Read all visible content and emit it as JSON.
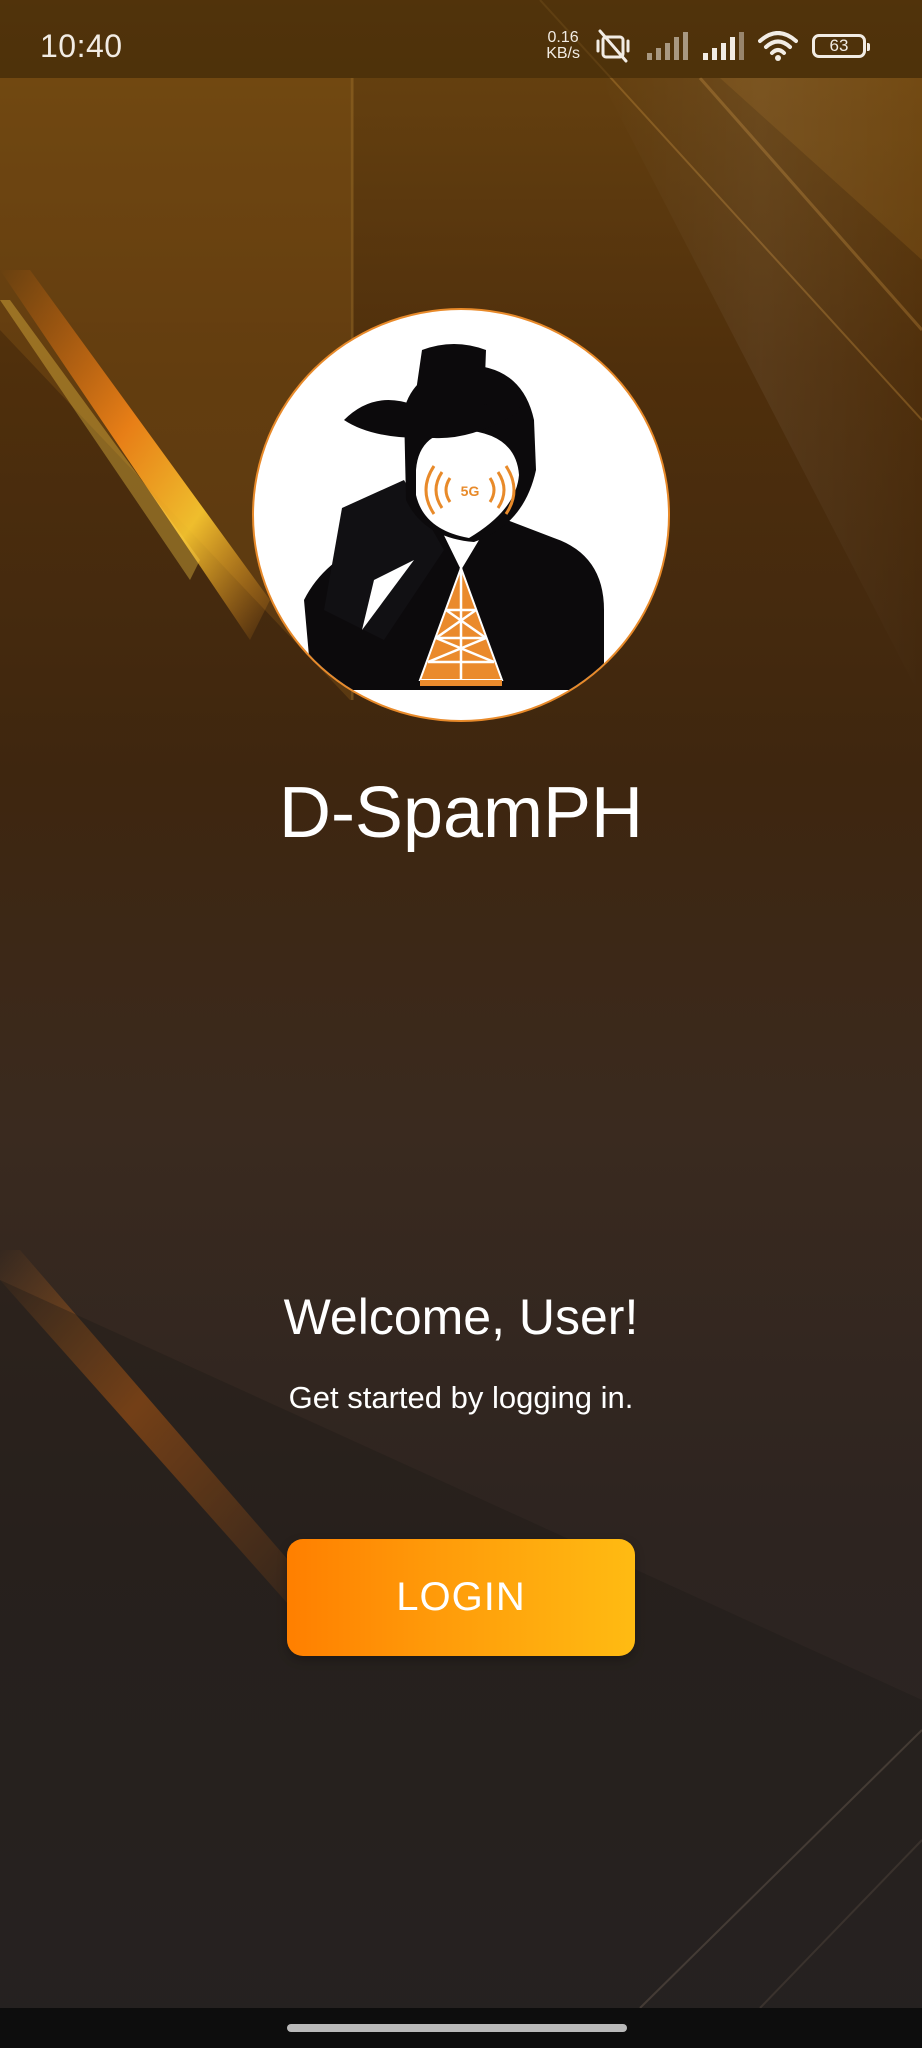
{
  "status_bar": {
    "time": "10:40",
    "net_speed_value": "0.16",
    "net_speed_unit": "KB/s",
    "battery_level": "63",
    "icons": [
      "mute-vibrate-icon",
      "signal-bars-icon",
      "signal-bars-icon",
      "wifi-icon",
      "battery-icon"
    ]
  },
  "app": {
    "name": "D-SpamPH",
    "logo_badge_text": "5G"
  },
  "welcome": {
    "heading": "Welcome, User!",
    "subtitle": "Get started by logging in."
  },
  "actions": {
    "login_label": "LOGIN"
  },
  "colors": {
    "accent_start": "#ff7f00",
    "accent_end": "#ffbb12",
    "logo_orange": "#e88a2a"
  }
}
